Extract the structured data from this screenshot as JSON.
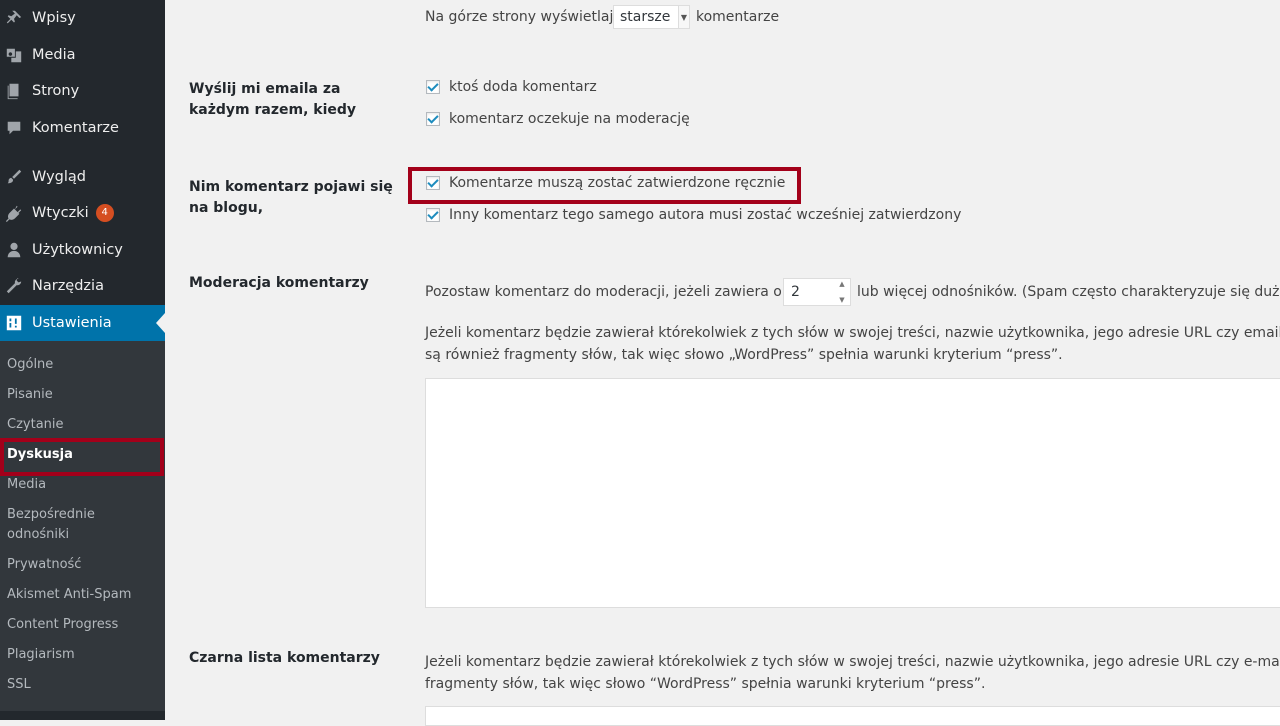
{
  "sidebar": {
    "menu": [
      {
        "label": "Wpisy",
        "icon": "pin-icon"
      },
      {
        "label": "Media",
        "icon": "media-icon"
      },
      {
        "label": "Strony",
        "icon": "pages-icon"
      },
      {
        "label": "Komentarze",
        "icon": "comments-icon"
      },
      {
        "label": "Wygląd",
        "icon": "brush-icon"
      },
      {
        "label": "Wtyczki",
        "icon": "plugin-icon",
        "badge": "4"
      },
      {
        "label": "Użytkownicy",
        "icon": "users-icon"
      },
      {
        "label": "Narzędzia",
        "icon": "wrench-icon"
      },
      {
        "label": "Ustawienia",
        "icon": "settings-icon"
      }
    ],
    "submenu": [
      {
        "label": "Ogólne"
      },
      {
        "label": "Pisanie"
      },
      {
        "label": "Czytanie"
      },
      {
        "label": "Dyskusja"
      },
      {
        "label": "Media"
      },
      {
        "label": "Bezpośrednie odnośniki"
      },
      {
        "label": "Prywatność"
      },
      {
        "label": "Akismet Anti-Spam"
      },
      {
        "label": "Content Progress"
      },
      {
        "label": "Plagiarism"
      },
      {
        "label": "SSL"
      }
    ]
  },
  "main": {
    "order": {
      "prefix": "Na górze strony wyświetlaj",
      "selected": "starsze",
      "suffix": "komentarze"
    },
    "email_section": {
      "label": "Wyślij mi emaila za każdym razem, kiedy",
      "options": [
        "ktoś doda komentarz",
        "komentarz oczekuje na moderację"
      ]
    },
    "before_section": {
      "label": "Nim komentarz pojawi się na blogu,",
      "options": [
        "Komentarze muszą zostać zatwierdzone ręcznie",
        "Inny komentarz tego samego autora musi zostać wcześniej zatwierdzony"
      ]
    },
    "moderation": {
      "label": "Moderacja komentarzy",
      "line_prefix": "Pozostaw komentarz do moderacji, jeżeli zawiera on",
      "links_value": "2",
      "line_suffix": "lub więcej odnośników. (Spam często charakteryzuje się dużą il",
      "desc_line1": "Jeżeli komentarz będzie zawierał którekolwiek z tych słów w swojej treści, nazwie użytkownika, jego adresie URL czy email lub",
      "desc_line2": "są również fragmenty słów, tak więc słowo „WordPress” spełnia warunki kryterium “press”."
    },
    "blacklist": {
      "label": "Czarna lista komentarzy",
      "desc_line1": "Jeżeli komentarz będzie zawierał którekolwiek z tych słów w swojej treści, nazwie użytkownika, jego adresie URL czy e-mailu lu",
      "desc_line2": "fragmenty słów, tak więc słowo “WordPress” spełnia warunki kryterium “press”."
    }
  },
  "colors": {
    "sidebar_bg": "#23282d",
    "submenu_bg": "#32373c",
    "active_bg": "#0073aa",
    "highlight": "#a3001a",
    "badge": "#d54e21"
  }
}
